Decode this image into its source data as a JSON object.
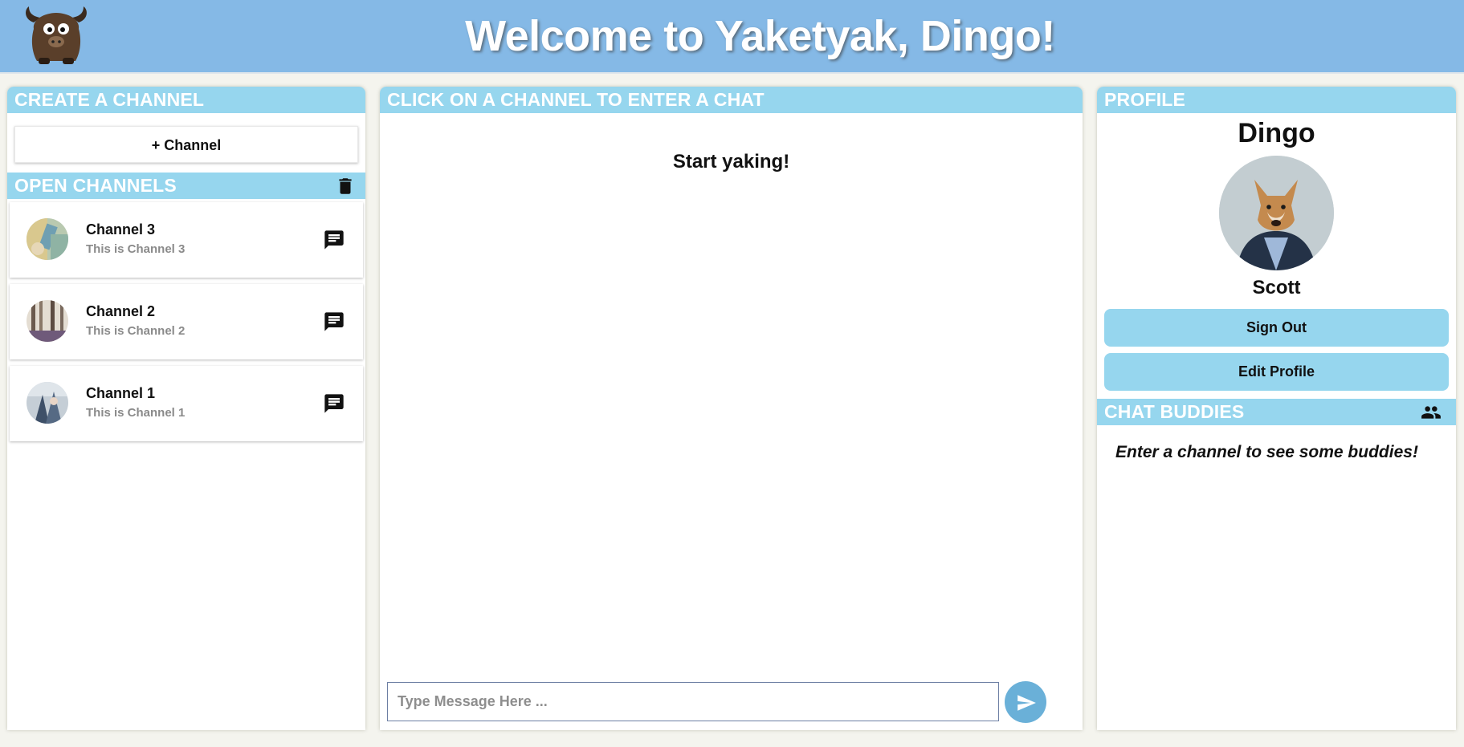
{
  "header": {
    "title": "Welcome to Yaketyak, Dingo!",
    "logo_icon": "yak-logo-icon"
  },
  "colors": {
    "header_bg": "#85b9e6",
    "bar_bg": "#96d6ee",
    "button_bg": "#96d6ee",
    "send_bg": "#6ab0d8"
  },
  "left_panel": {
    "create_title": "CREATE A CHANNEL",
    "add_channel_label": "+ Channel",
    "open_title": "OPEN CHANNELS",
    "delete_icon": "trash-icon",
    "channels": [
      {
        "name": "Channel 3",
        "description": "This is Channel 3",
        "icon": "chat-icon"
      },
      {
        "name": "Channel 2",
        "description": "This is Channel 2",
        "icon": "chat-icon"
      },
      {
        "name": "Channel 1",
        "description": "This is Channel 1",
        "icon": "chat-icon"
      }
    ]
  },
  "middle_panel": {
    "title": "CLICK ON A CHANNEL TO ENTER A CHAT",
    "start_text": "Start yaking!",
    "input_placeholder": "Type Message Here ...",
    "input_value": "",
    "send_icon": "send-icon"
  },
  "right_panel": {
    "profile_title": "PROFILE",
    "username": "Dingo",
    "real_name": "Scott",
    "sign_out_label": "Sign Out",
    "edit_profile_label": "Edit Profile",
    "buddies_title": "CHAT BUDDIES",
    "buddies_icon": "people-icon",
    "buddies_message": "Enter a channel to see some buddies!"
  }
}
